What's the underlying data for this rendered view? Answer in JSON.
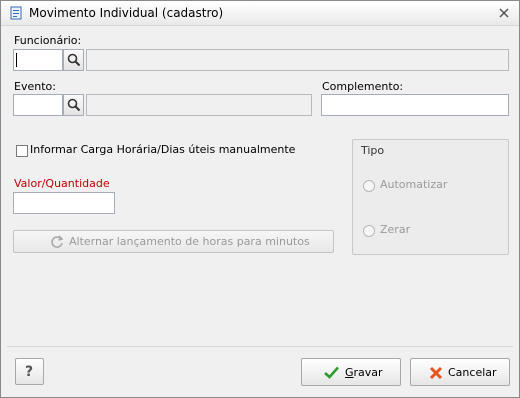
{
  "window": {
    "title": "Movimento Individual (cadastro)"
  },
  "fields": {
    "funcionario_label": "Funcionário:",
    "evento_label": "Evento:",
    "complemento_label": "Complemento:",
    "checkbox_label": "Informar Carga Horária/Dias úteis manualmente",
    "valor_label": "Valor/Quantidade",
    "alternar_label": "Alternar lançamento de horas para minutos"
  },
  "tipo": {
    "title": "Tipo",
    "options": [
      "Automatizar",
      "Zerar"
    ]
  },
  "footer": {
    "help_label": "?",
    "gravar_first": "G",
    "gravar_rest": "ravar",
    "cancelar_label": "Cancelar"
  },
  "colors": {
    "required_label": "#c00000",
    "accent_check": "#2e9b2e",
    "cancel_x": "#e5541c"
  }
}
